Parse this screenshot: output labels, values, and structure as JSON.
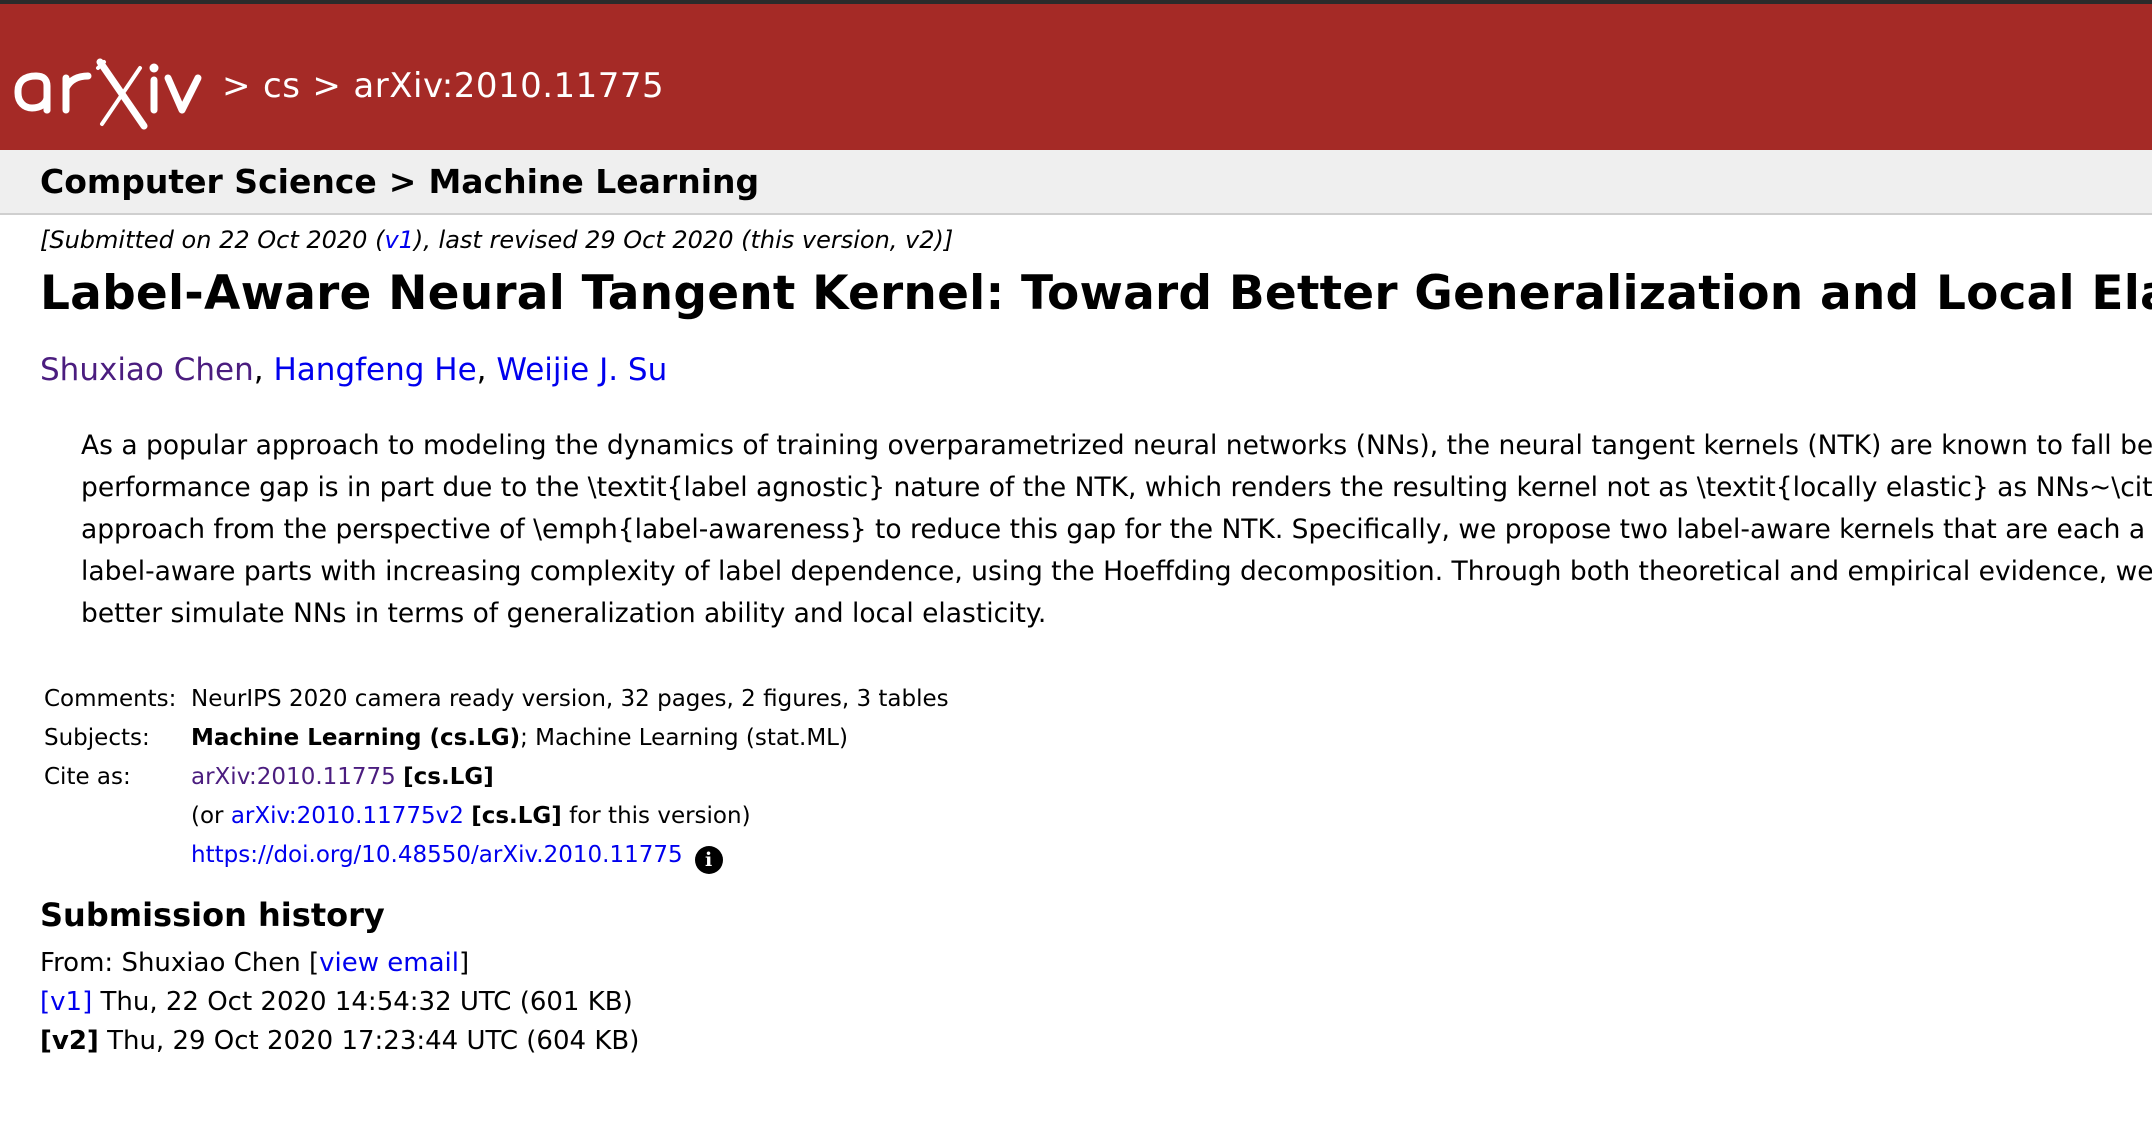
{
  "header": {
    "logo_text": "arXiv",
    "crumbs": [
      "cs",
      "arXiv:2010.11775"
    ],
    "separator": ">"
  },
  "subject_bar": {
    "crumbs": [
      "Computer Science",
      "Machine Learning"
    ],
    "separator": ">"
  },
  "dateline": {
    "prefix": "[Submitted on 22 Oct 2020 (",
    "v1_link": "v1",
    "suffix": "), last revised 29 Oct 2020 (this version, v2)]"
  },
  "title": "Label-Aware Neural Tangent Kernel: Toward Better Generalization and Local Elasticity",
  "authors": [
    "Shuxiao Chen",
    "Hangfeng He",
    "Weijie J. Su"
  ],
  "author_separator": ",",
  "abstract_lines": [
    "As a popular approach to modeling the dynamics of training overparametrized neural networks (NNs), the neural tangent kernels (NTK) are known to fall beh",
    "performance gap is in part due to the \\textit{label agnostic} nature of the NTK, which renders the resulting kernel not as \\textit{locally elastic} as NNs~\\citep",
    "approach from the perspective of \\emph{label-awareness} to reduce this gap for the NTK. Specifically, we propose two label-aware kernels that are each a su",
    "label-aware parts with increasing complexity of label dependence, using the Hoeffding decomposition. Through both theoretical and empirical evidence, we",
    "better simulate NNs in terms of generalization ability and local elasticity."
  ],
  "meta": {
    "comments_label": "Comments:",
    "comments_value": "NeurIPS 2020 camera ready version, 32 pages, 2 figures, 3 tables",
    "subjects_label": "Subjects:",
    "subjects_primary": "Machine Learning (cs.LG)",
    "subjects_rest": "; Machine Learning (stat.ML)",
    "cite_label": "Cite as:",
    "cite_id": "arXiv:2010.11775",
    "cite_cat": "[cs.LG]",
    "cite_version_prefix": "(or ",
    "cite_version_id": "arXiv:2010.11775v2",
    "cite_version_cat": "[cs.LG]",
    "cite_version_suffix": " for this version)",
    "doi": "https://doi.org/10.48550/arXiv.2010.11775",
    "info_icon": "i"
  },
  "history": {
    "heading": "Submission history",
    "from_prefix": "From: Shuxiao Chen [",
    "view_email": "view email",
    "from_suffix": "]",
    "v1_label": "[v1]",
    "v1_text": " Thu, 22 Oct 2020 14:54:32 UTC (601 KB)",
    "v2_label": "[v2]",
    "v2_text": " Thu, 29 Oct 2020 17:23:44 UTC (604 KB)"
  },
  "colors": {
    "header_bg": "#a52a26",
    "link": "#0000ee",
    "visited_link": "#4b1d7f",
    "subject_bar_bg": "#efefef"
  }
}
